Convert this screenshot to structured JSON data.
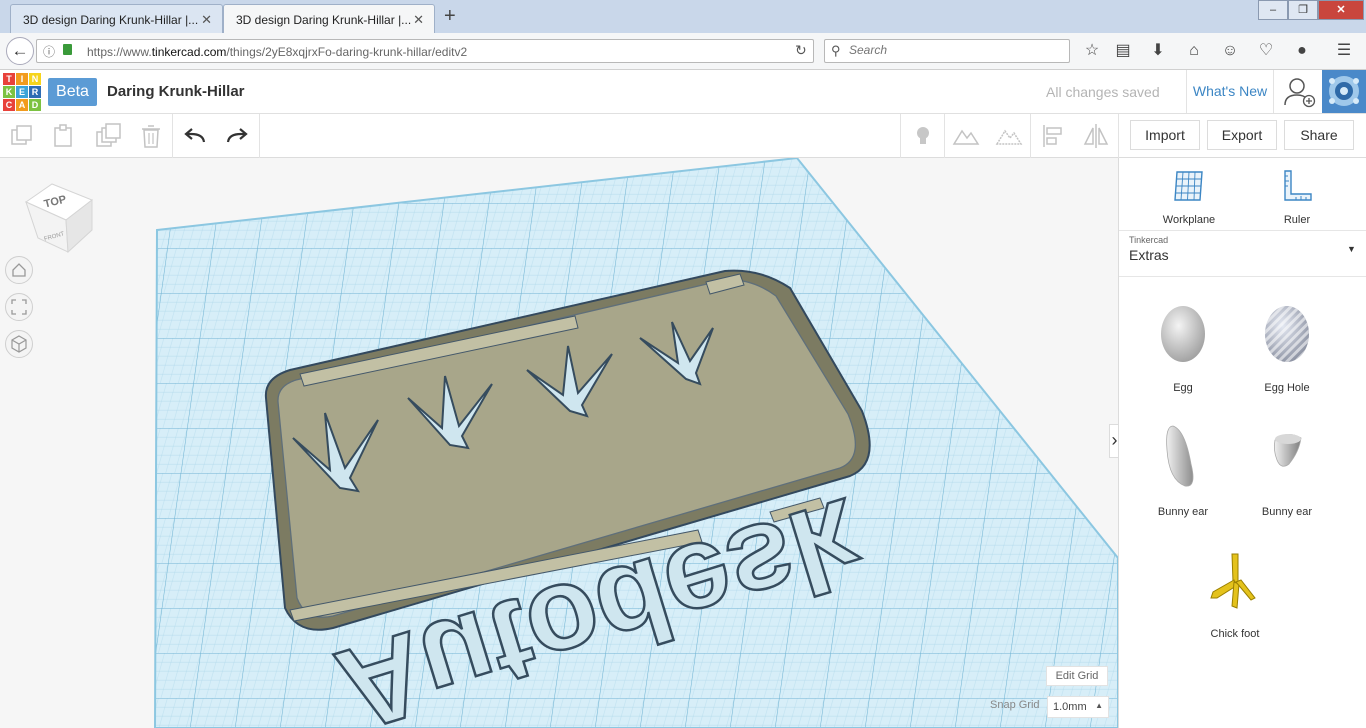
{
  "browser": {
    "tabs": [
      {
        "title": "3D design Daring Krunk-Hillar |...",
        "active": false
      },
      {
        "title": "3D design Daring Krunk-Hillar |...",
        "active": true
      }
    ],
    "new_tab_icon": "+",
    "window_controls": {
      "minimize": "–",
      "restore": "❐",
      "close": "✕"
    },
    "url": {
      "prefix": "https://www.",
      "host": "tinkercad.com",
      "path": "/things/2yE8xqjrxFo-daring-krunk-hillar/editv2"
    },
    "search_placeholder": "Search"
  },
  "app": {
    "logo_letters": [
      "TIN",
      "KER",
      "CAD"
    ],
    "logo_colors": [
      "#e8413a",
      "#f29b1d",
      "#f6d41b",
      "#7cc242",
      "#3aa3d9",
      "#2e6db4",
      "#e8413a",
      "#f29b1d",
      "#7cc242"
    ],
    "beta_label": "Beta",
    "design_name": "Daring Krunk-Hillar",
    "save_status": "All changes saved",
    "whats_new": "What's New"
  },
  "toolbar": {
    "import": "Import",
    "export": "Export",
    "share": "Share"
  },
  "workspace": {
    "viewcube_top": "TOP",
    "viewcube_front": "FRONT",
    "edit_grid": "Edit Grid",
    "snap_label": "Snap Grid",
    "snap_value": "1.0mm",
    "model_text": "Autodesk",
    "model_color": "#a8a68a",
    "grid_color": "#bfe0ee"
  },
  "panel": {
    "workplane": "Workplane",
    "ruler": "Ruler",
    "category_source": "Tinkercad",
    "category_name": "Extras",
    "shapes": [
      {
        "name": "Egg"
      },
      {
        "name": "Egg Hole"
      },
      {
        "name": "Bunny ear"
      },
      {
        "name": "Bunny ear"
      },
      {
        "name": "Chick foot"
      }
    ]
  }
}
